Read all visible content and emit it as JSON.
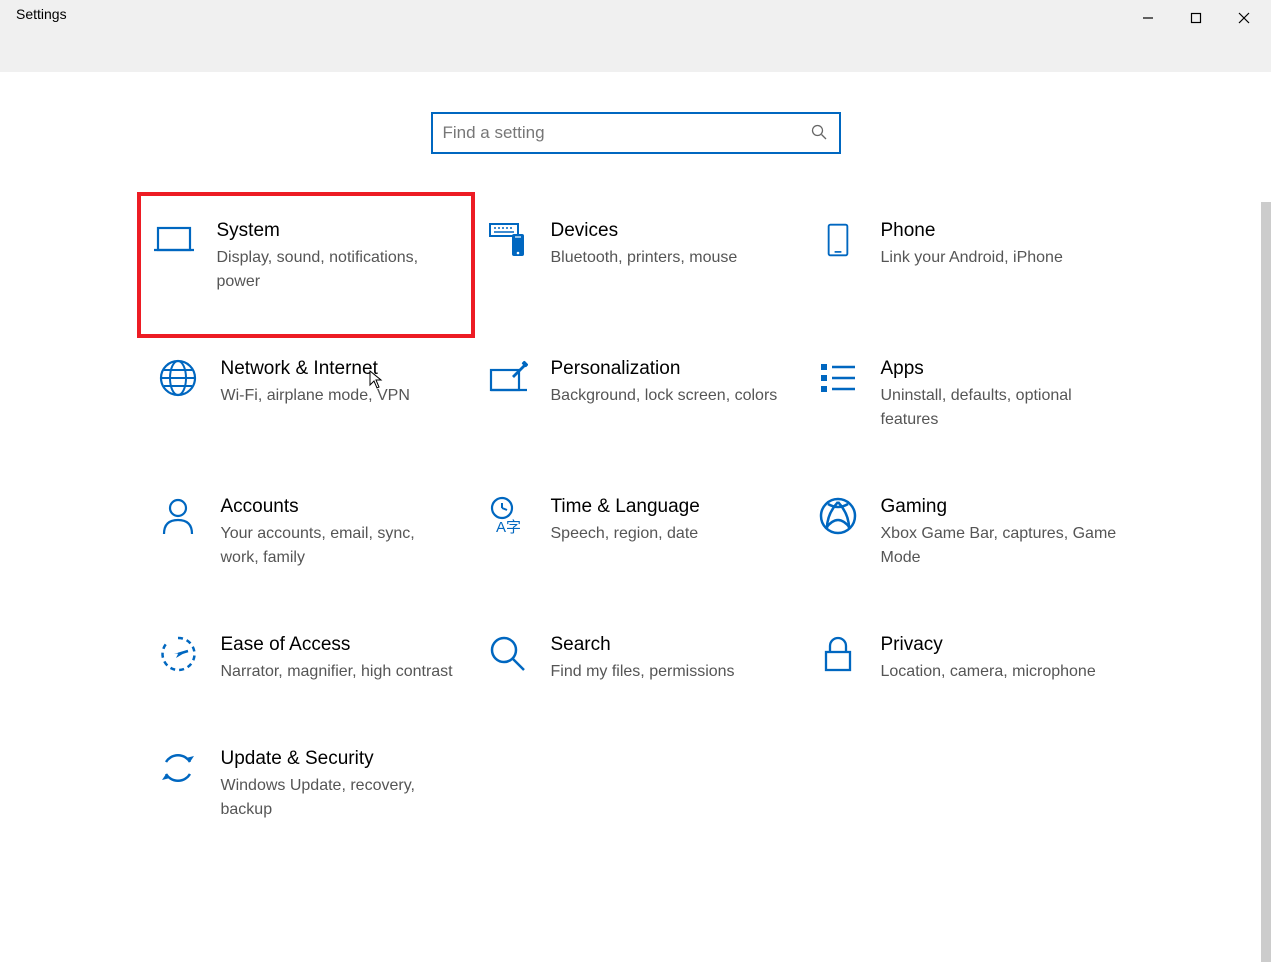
{
  "window": {
    "title": "Settings"
  },
  "search": {
    "placeholder": "Find a setting"
  },
  "categories": [
    {
      "id": "system",
      "title": "System",
      "desc": "Display, sound, notifications, power",
      "highlighted": true
    },
    {
      "id": "devices",
      "title": "Devices",
      "desc": "Bluetooth, printers, mouse"
    },
    {
      "id": "phone",
      "title": "Phone",
      "desc": "Link your Android, iPhone"
    },
    {
      "id": "network",
      "title": "Network & Internet",
      "desc": "Wi-Fi, airplane mode, VPN"
    },
    {
      "id": "personalization",
      "title": "Personalization",
      "desc": "Background, lock screen, colors"
    },
    {
      "id": "apps",
      "title": "Apps",
      "desc": "Uninstall, defaults, optional features"
    },
    {
      "id": "accounts",
      "title": "Accounts",
      "desc": "Your accounts, email, sync, work, family"
    },
    {
      "id": "time",
      "title": "Time & Language",
      "desc": "Speech, region, date"
    },
    {
      "id": "gaming",
      "title": "Gaming",
      "desc": "Xbox Game Bar, captures, Game Mode"
    },
    {
      "id": "ease",
      "title": "Ease of Access",
      "desc": "Narrator, magnifier, high contrast"
    },
    {
      "id": "searchcat",
      "title": "Search",
      "desc": "Find my files, permissions"
    },
    {
      "id": "privacy",
      "title": "Privacy",
      "desc": "Location, camera, microphone"
    },
    {
      "id": "update",
      "title": "Update & Security",
      "desc": "Windows Update, recovery, backup"
    }
  ]
}
